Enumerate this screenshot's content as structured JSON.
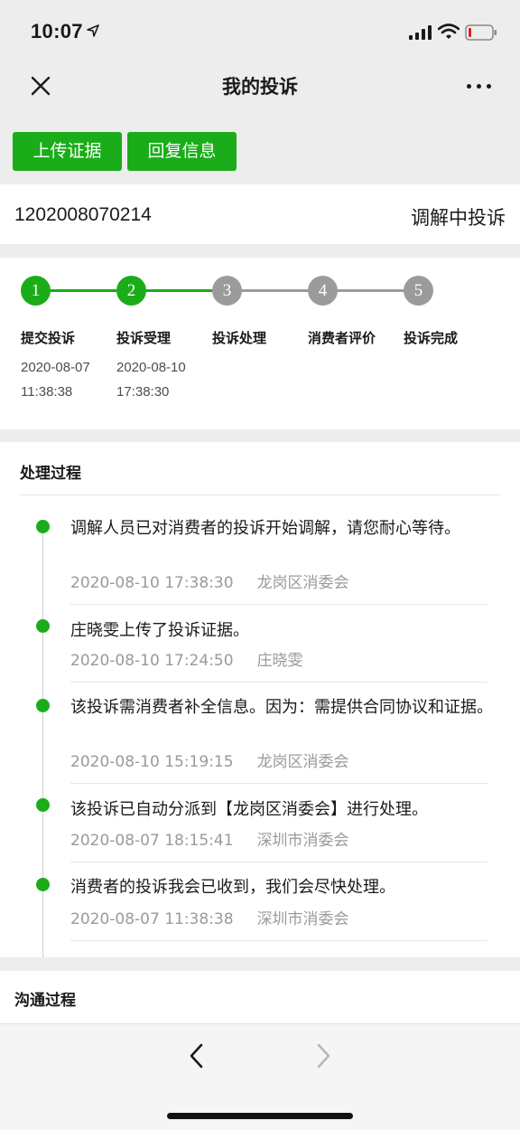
{
  "status_bar": {
    "time": "10:07",
    "icons": [
      "location-arrow-icon",
      "signal-icon",
      "wifi-icon",
      "battery-low-icon"
    ]
  },
  "nav": {
    "title": "我的投诉",
    "close_icon": "close-icon",
    "more_icon": "more-icon"
  },
  "actions": {
    "upload_label": "上传证据",
    "reply_label": "回复信息"
  },
  "complaint": {
    "id": "1202008070214",
    "status": "调解中投诉"
  },
  "steps": [
    {
      "number": "1",
      "name": "提交投诉",
      "date": "2020-08-07",
      "clock": "11:38:38",
      "done": true
    },
    {
      "number": "2",
      "name": "投诉受理",
      "date": "2020-08-10",
      "clock": "17:38:30",
      "done": true
    },
    {
      "number": "3",
      "name": "投诉处理",
      "date": "",
      "clock": "",
      "done": false
    },
    {
      "number": "4",
      "name": "消费者评价",
      "date": "",
      "clock": "",
      "done": false
    },
    {
      "number": "5",
      "name": "投诉完成",
      "date": "",
      "clock": "",
      "done": false
    }
  ],
  "process": {
    "title": "处理过程",
    "entries": [
      {
        "text": "调解人员已对消费者的投诉开始调解，请您耐心等待。",
        "time": "2020-08-10 17:38:30",
        "source": "龙岗区消委会"
      },
      {
        "text": "庄晓雯上传了投诉证据。",
        "time": "2020-08-10 17:24:50",
        "source": "庄晓雯"
      },
      {
        "text": "该投诉需消费者补全信息。因为：需提供合同协议和证据。",
        "time": "2020-08-10 15:19:15",
        "source": "龙岗区消委会"
      },
      {
        "text": "该投诉已自动分派到【龙岗区消委会】进行处理。",
        "time": "2020-08-07 18:15:41",
        "source": "深圳市消委会"
      },
      {
        "text": "消费者的投诉我会已收到，我们会尽快处理。",
        "time": "2020-08-07 11:38:38",
        "source": "深圳市消委会"
      }
    ]
  },
  "communication": {
    "title": "沟通过程"
  },
  "toolbar": {
    "back_icon": "chevron-left-icon",
    "forward_icon": "chevron-right-icon"
  },
  "colors": {
    "accent": "#1aad19",
    "step_inactive": "#9b9b9b",
    "background": "#ededed",
    "muted_text": "#9a9a9a"
  }
}
